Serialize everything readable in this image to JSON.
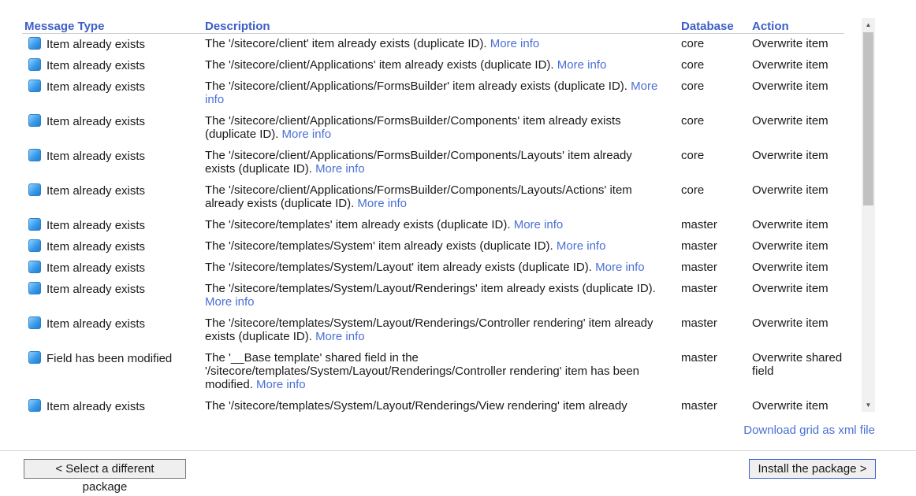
{
  "grid": {
    "headers": {
      "message_type": "Message Type",
      "description": "Description",
      "database": "Database",
      "action": "Action"
    },
    "more_info_label": "More info",
    "rows": [
      {
        "type": "Item already exists",
        "desc": "The '/sitecore/client' item already exists (duplicate ID).",
        "db": "core",
        "action": "Overwrite item"
      },
      {
        "type": "Item already exists",
        "desc": "The '/sitecore/client/Applications' item already exists (duplicate ID).",
        "db": "core",
        "action": "Overwrite item"
      },
      {
        "type": "Item already exists",
        "desc": "The '/sitecore/client/Applications/FormsBuilder' item already exists (duplicate ID).",
        "db": "core",
        "action": "Overwrite item"
      },
      {
        "type": "Item already exists",
        "desc": "The '/sitecore/client/Applications/FormsBuilder/Components' item already exists (duplicate ID).",
        "db": "core",
        "action": "Overwrite item"
      },
      {
        "type": "Item already exists",
        "desc": "The '/sitecore/client/Applications/FormsBuilder/Components/Layouts' item already exists (duplicate ID).",
        "db": "core",
        "action": "Overwrite item"
      },
      {
        "type": "Item already exists",
        "desc": "The '/sitecore/client/Applications/FormsBuilder/Components/Layouts/Actions' item already exists (duplicate ID).",
        "db": "core",
        "action": "Overwrite item"
      },
      {
        "type": "Item already exists",
        "desc": "The '/sitecore/templates' item already exists (duplicate ID).",
        "db": "master",
        "action": "Overwrite item"
      },
      {
        "type": "Item already exists",
        "desc": "The '/sitecore/templates/System' item already exists (duplicate ID).",
        "db": "master",
        "action": "Overwrite item"
      },
      {
        "type": "Item already exists",
        "desc": "The '/sitecore/templates/System/Layout' item already exists (duplicate ID).",
        "db": "master",
        "action": "Overwrite item"
      },
      {
        "type": "Item already exists",
        "desc": "The '/sitecore/templates/System/Layout/Renderings' item already exists (duplicate ID).",
        "db": "master",
        "action": "Overwrite item"
      },
      {
        "type": "Item already exists",
        "desc": "The '/sitecore/templates/System/Layout/Renderings/Controller rendering' item already exists (duplicate ID).",
        "db": "master",
        "action": "Overwrite item"
      },
      {
        "type": "Field has been modified",
        "desc": "The '__Base template' shared field in the '/sitecore/templates/System/Layout/Renderings/Controller rendering' item has been modified.",
        "db": "master",
        "action": "Overwrite shared field"
      },
      {
        "type": "Item already exists",
        "desc": "The '/sitecore/templates/System/Layout/Renderings/View rendering' item already",
        "db": "master",
        "action": "Overwrite item"
      }
    ]
  },
  "download_link": "Download grid as xml file",
  "buttons": {
    "back": "< Select a different package",
    "install": "Install the package >"
  }
}
